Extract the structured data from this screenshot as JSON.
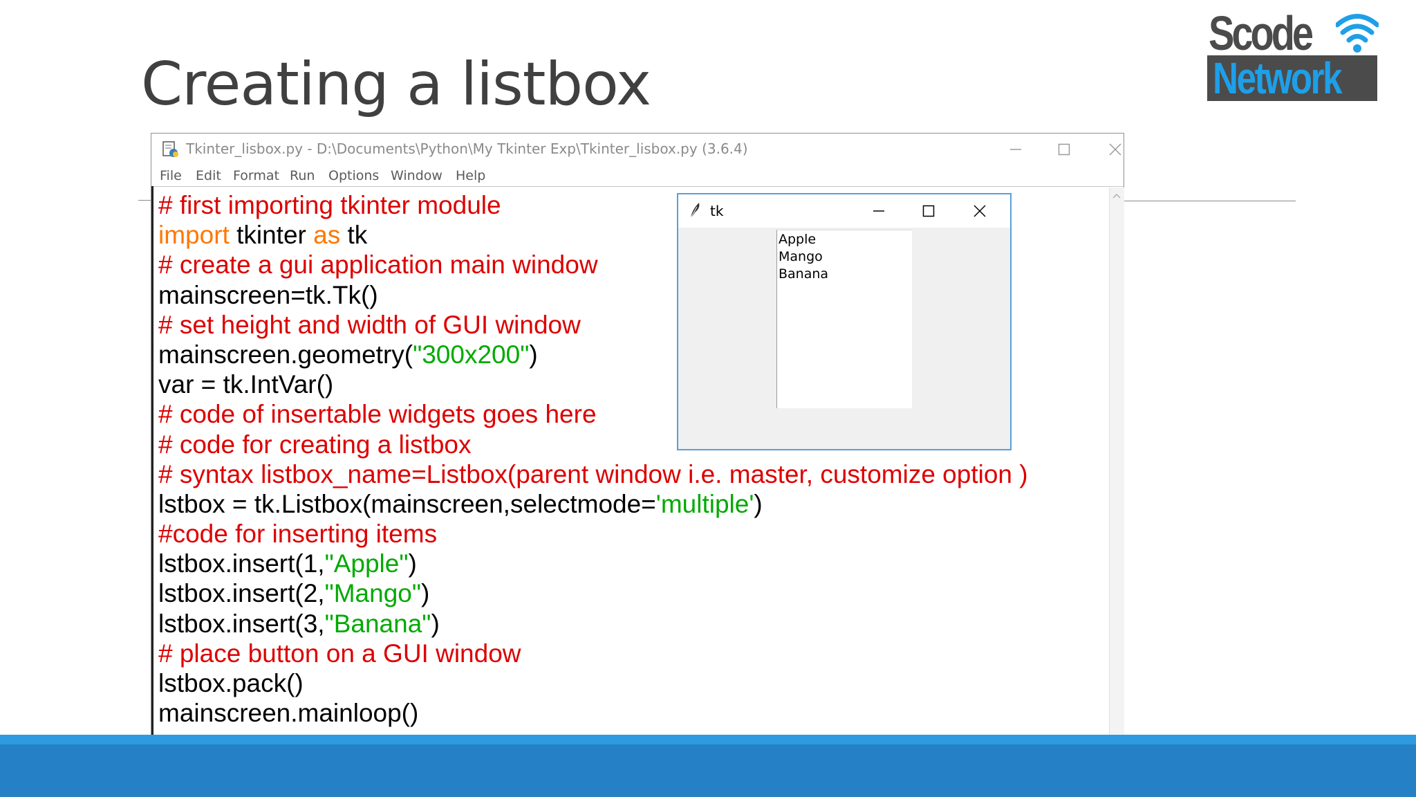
{
  "slide": {
    "title": "Creating a listbox"
  },
  "logo": {
    "line1": "Scode",
    "line2": "Network"
  },
  "idle": {
    "title": "Tkinter_lisbox.py - D:\\Documents\\Python\\My Tkinter Exp\\Tkinter_lisbox.py (3.6.4)",
    "menu": [
      "File",
      "Edit",
      "Format",
      "Run",
      "Options",
      "Window",
      "Help"
    ],
    "code": [
      [
        {
          "t": "# first importing tkinter module",
          "c": "cm"
        }
      ],
      [
        {
          "t": "import",
          "c": "kw"
        },
        {
          "t": " tkinter ",
          "c": ""
        },
        {
          "t": "as",
          "c": "kw"
        },
        {
          "t": " tk",
          "c": ""
        }
      ],
      [
        {
          "t": "# create a gui application main window",
          "c": "cm"
        }
      ],
      [
        {
          "t": "mainscreen=tk.Tk()",
          "c": ""
        }
      ],
      [
        {
          "t": "# set height and width of GUI window",
          "c": "cm"
        }
      ],
      [
        {
          "t": "mainscreen.geometry(",
          "c": ""
        },
        {
          "t": "\"300x200\"",
          "c": "st"
        },
        {
          "t": ")",
          "c": ""
        }
      ],
      [
        {
          "t": "var = tk.IntVar()",
          "c": ""
        }
      ],
      [
        {
          "t": "# code of insertable widgets goes here",
          "c": "cm"
        }
      ],
      [
        {
          "t": "# code for creating a listbox",
          "c": "cm"
        }
      ],
      [
        {
          "t": "# syntax listbox_name=Listbox(parent window i.e. master, customize option )",
          "c": "cm"
        }
      ],
      [
        {
          "t": "lstbox = tk.Listbox(mainscreen,selectmode=",
          "c": ""
        },
        {
          "t": "'multiple'",
          "c": "st"
        },
        {
          "t": ")",
          "c": ""
        }
      ],
      [
        {
          "t": "#code for inserting items",
          "c": "cm"
        }
      ],
      [
        {
          "t": "lstbox.insert(1,",
          "c": ""
        },
        {
          "t": "\"Apple\"",
          "c": "st"
        },
        {
          "t": ")",
          "c": ""
        }
      ],
      [
        {
          "t": "lstbox.insert(2,",
          "c": ""
        },
        {
          "t": "\"Mango\"",
          "c": "st"
        },
        {
          "t": ")",
          "c": ""
        }
      ],
      [
        {
          "t": "lstbox.insert(3,",
          "c": ""
        },
        {
          "t": "\"Banana\"",
          "c": "st"
        },
        {
          "t": ")",
          "c": ""
        }
      ],
      [
        {
          "t": "# place button on a GUI window",
          "c": "cm"
        }
      ],
      [
        {
          "t": "lstbox.pack()",
          "c": ""
        }
      ],
      [
        {
          "t": "mainscreen.mainloop()",
          "c": ""
        }
      ]
    ]
  },
  "tk": {
    "title": "tk",
    "listbox_items": [
      "Apple",
      "Mango",
      "Banana"
    ]
  },
  "colors": {
    "comment": "#dd0000",
    "keyword": "#ff7700",
    "string": "#00aa00",
    "band": "#2680c5",
    "band_light": "#2e9be0",
    "tk_border": "#5a9ed8"
  }
}
